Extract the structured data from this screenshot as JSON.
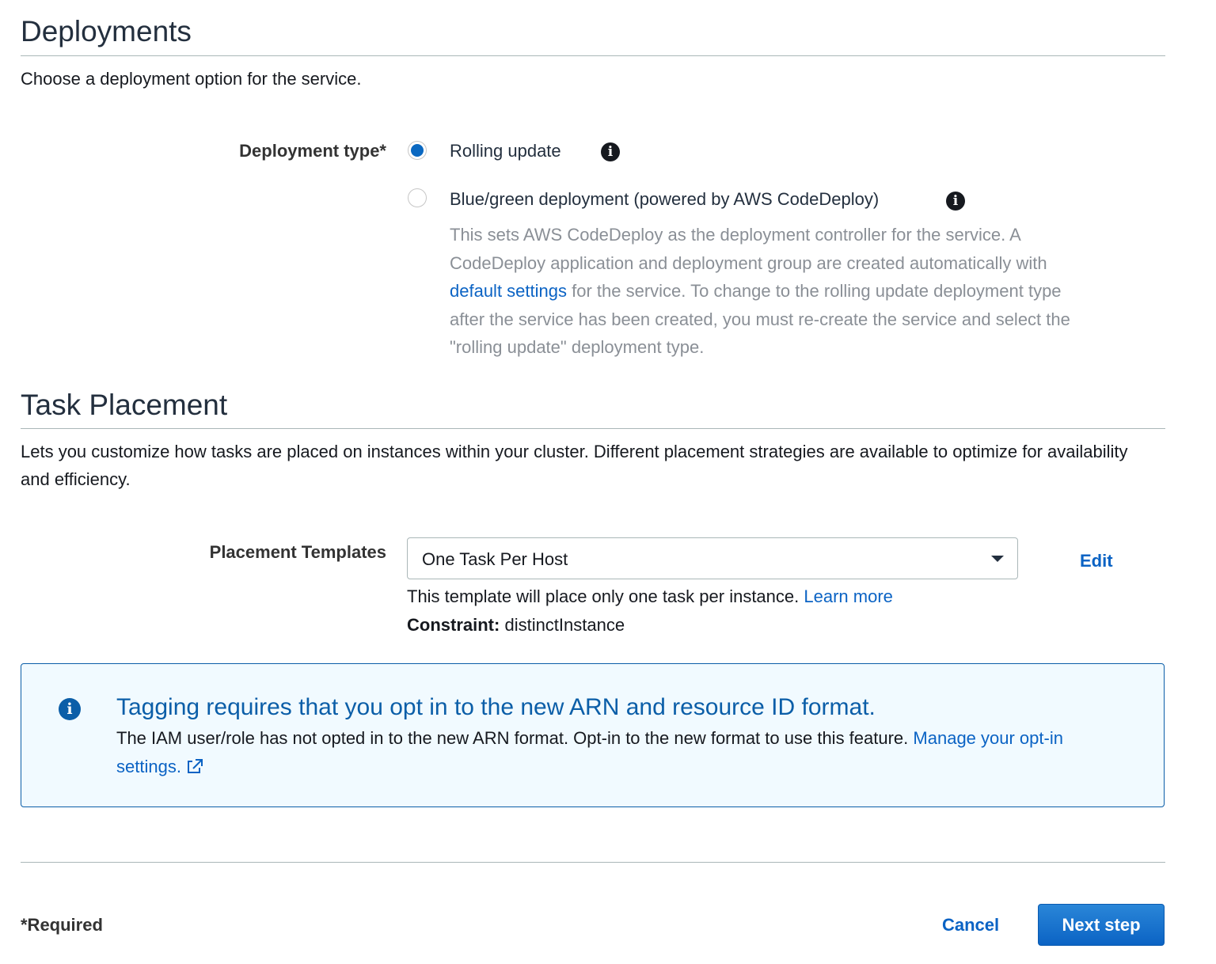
{
  "deployments": {
    "title": "Deployments",
    "description": "Choose a deployment option for the service.",
    "deployment_type_label": "Deployment type*",
    "options": [
      {
        "label": "Rolling update",
        "selected": true
      },
      {
        "label": "Blue/green deployment (powered by AWS CodeDeploy)",
        "selected": false
      }
    ],
    "help": {
      "text_before": "This sets AWS CodeDeploy as the deployment controller for the service. A CodeDeploy application and deployment group are created automatically with",
      "link": "default settings",
      "text_after": "for the service. To change to the rolling update deployment type after the service has been created, you must re-create the service and select the \"rolling update\" deployment type."
    }
  },
  "task_placement": {
    "title": "Task Placement",
    "description": "Lets you customize how tasks are placed on instances within your cluster. Different placement strategies are available to optimize for availability and efficiency.",
    "placement_templates_label": "Placement Templates",
    "selected_template": "One Task Per Host",
    "edit_label": "Edit",
    "template_help": "This template will place only one task per instance.",
    "learn_more": "Learn more",
    "constraint_label": "Constraint:",
    "constraint_value": "distinctInstance"
  },
  "info_alert": {
    "icon": "info-icon",
    "title": "Tagging requires that you opt in to the new ARN and resource ID format.",
    "body": "The IAM user/role has not opted in to the new ARN format. Opt-in to the new format to use this feature.",
    "link": "Manage your opt-in settings.",
    "link_icon": "external-link-icon",
    "accent_color": "#0b5ea8",
    "background_color": "#f1faff"
  },
  "footer": {
    "required_note": "*Required",
    "cancel_label": "Cancel",
    "next_label": "Next step",
    "primary_color": "#0b63c4"
  }
}
